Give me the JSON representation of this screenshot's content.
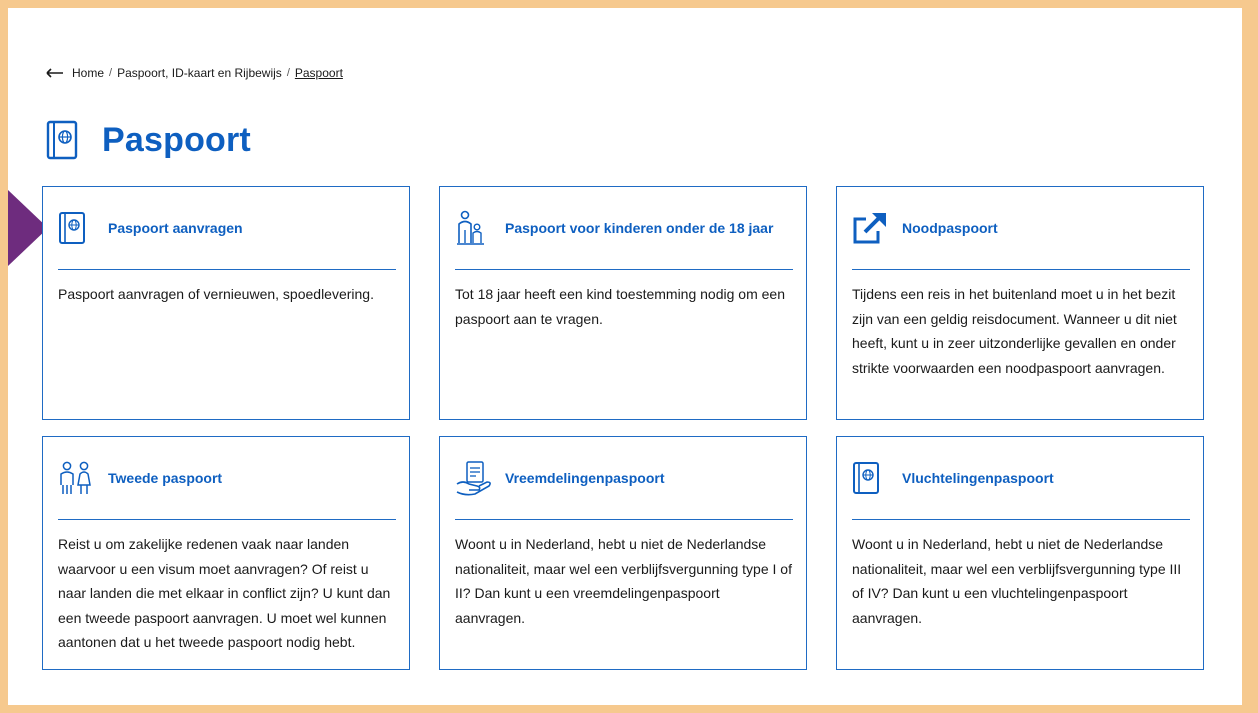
{
  "breadcrumb": {
    "back_icon": "arrow-left-icon",
    "items": [
      "Home",
      "Paspoort, ID-kaart en Rijbewijs",
      "Paspoort"
    ],
    "separator": "/"
  },
  "page": {
    "title": "Paspoort",
    "title_icon": "passport-icon"
  },
  "colors": {
    "accent": "#0e5fc0",
    "border": "#1f6bc4",
    "background_frame": "#f6c98e",
    "marker": "#6e2c7e"
  },
  "cards": [
    {
      "icon": "passport-icon",
      "title": "Paspoort aanvragen",
      "description": "Paspoort aanvragen of vernieuwen, spoedlevering."
    },
    {
      "icon": "parent-child-icon",
      "title": "Paspoort voor kinderen onder de 18 jaar",
      "description": "Tot 18 jaar heeft een kind toestemming nodig om een paspoort aan te vragen."
    },
    {
      "icon": "external-link-icon",
      "title": "Noodpaspoort",
      "description": "Tijdens een reis in het buitenland moet u in het bezit zijn van een geldig reisdocument. Wanneer u dit niet heeft, kunt u in zeer uitzonderlijke gevallen en onder strikte voorwaarden een noodpaspoort aanvragen."
    },
    {
      "icon": "two-people-icon",
      "title": "Tweede paspoort",
      "description": "Reist u om zakelijke redenen vaak naar landen waarvoor u een visum moet aanvragen? Of reist u naar landen die met elkaar in conflict zijn? U kunt dan een tweede paspoort aanvragen. U moet wel kunnen aantonen dat u het tweede paspoort nodig hebt."
    },
    {
      "icon": "document-hand-icon",
      "title": "Vreemdelingenpaspoort",
      "description": "Woont u in Nederland, hebt u niet de Nederlandse nationaliteit, maar wel een verblijfsvergunning type I of II? Dan kunt u een vreemdelingenpaspoort aanvragen."
    },
    {
      "icon": "passport-icon",
      "title": "Vluchtelingenpaspoort",
      "description": "Woont u in Nederland, hebt u niet de Nederlandse nationaliteit, maar wel een verblijfsvergunning type III of IV? Dan kunt u een vluchtelingenpaspoort aanvragen."
    }
  ]
}
